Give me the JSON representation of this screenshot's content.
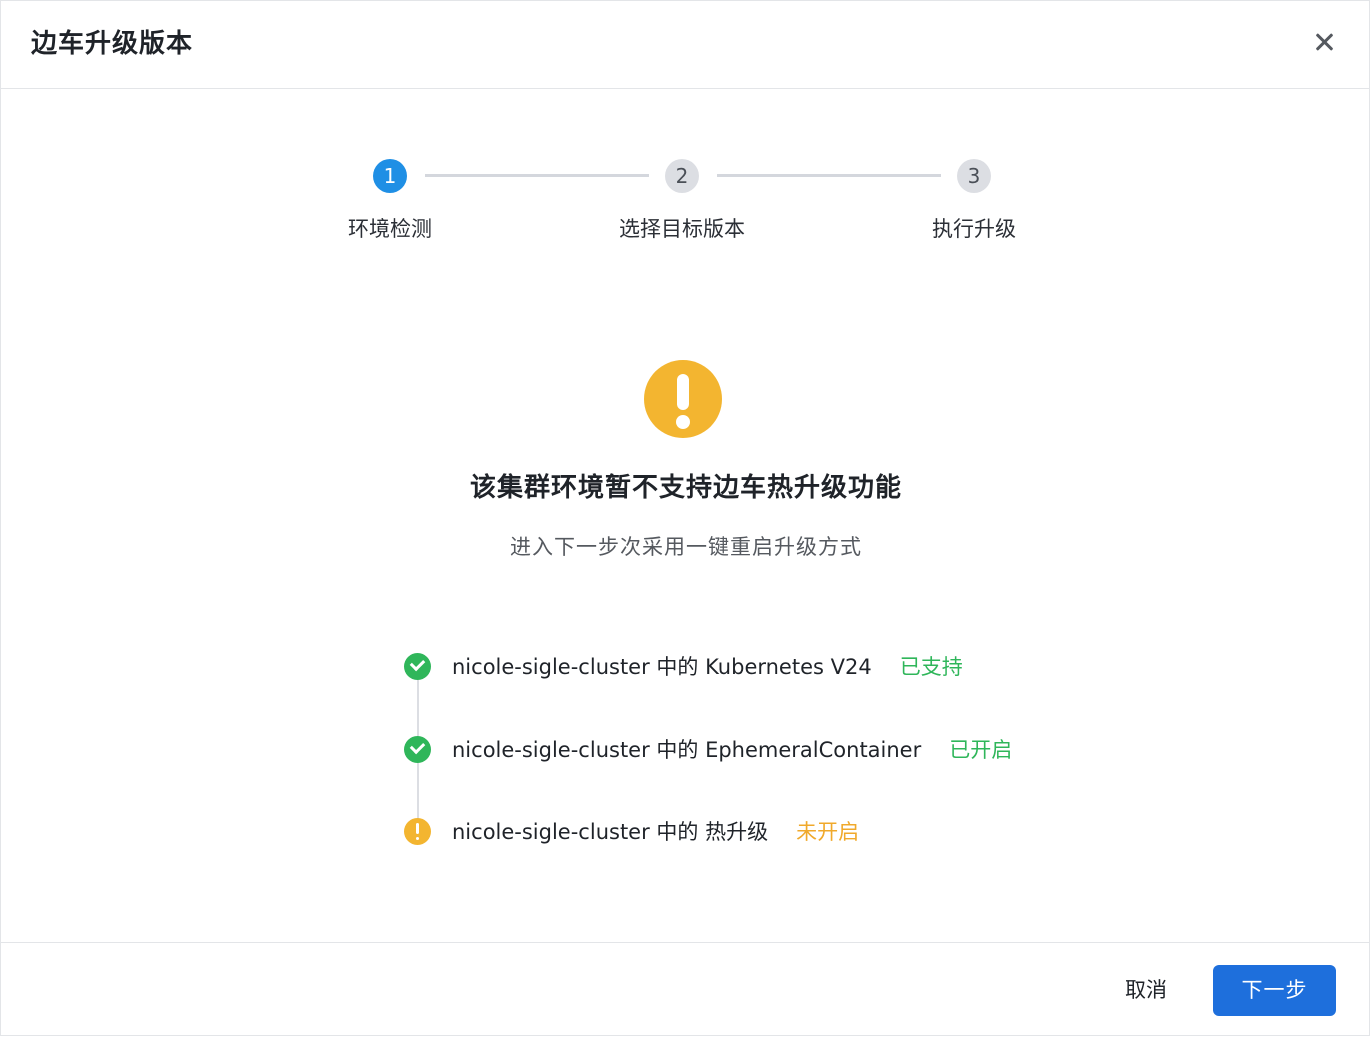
{
  "dialog": {
    "title": "边车升级版本",
    "close_icon": "close-icon"
  },
  "steps": [
    {
      "number": "1",
      "label": "环境检测",
      "state": "active"
    },
    {
      "number": "2",
      "label": "选择目标版本",
      "state": "pending"
    },
    {
      "number": "3",
      "label": "执行升级",
      "state": "pending"
    }
  ],
  "result": {
    "icon": "warning-icon",
    "title": "该集群环境暂不支持边车热升级功能",
    "subtitle": "进入下一步次采用一键重启升级方式"
  },
  "checks": [
    {
      "text": "nicole-sigle-cluster 中的 Kubernetes V24",
      "status": "已支持",
      "icon": "check-circle-icon",
      "level": "ok"
    },
    {
      "text": "nicole-sigle-cluster 中的 EphemeralContainer",
      "status": "已开启",
      "icon": "check-circle-icon",
      "level": "ok"
    },
    {
      "text": "nicole-sigle-cluster 中的 热升级",
      "status": "未开启",
      "icon": "warning-circle-icon",
      "level": "warn"
    }
  ],
  "footer": {
    "cancel_label": "取消",
    "next_label": "下一步"
  },
  "colors": {
    "primary": "#1e6fdc",
    "step_active": "#1f8fe5",
    "success": "#2fb65a",
    "warning": "#f3b530"
  }
}
